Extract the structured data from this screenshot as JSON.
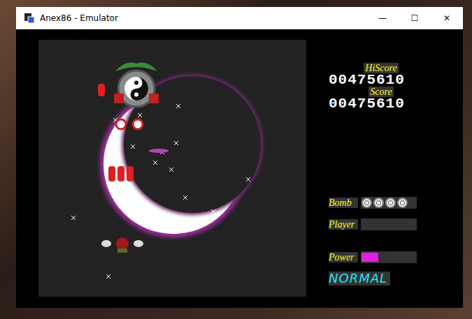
{
  "window": {
    "title": "Anex86 - Emulator",
    "controls": [
      "—",
      "☐",
      "✕"
    ]
  },
  "hud": {
    "hiscore_label": "HiScore",
    "hiscore": "00475610",
    "score_label": "Score",
    "score": "00475610",
    "bomb_label": "Bomb",
    "bombs": 4,
    "player_label": "Player",
    "lives": 0,
    "power_label": "Power",
    "power_level": 0.3,
    "difficulty": "NORMAL"
  }
}
